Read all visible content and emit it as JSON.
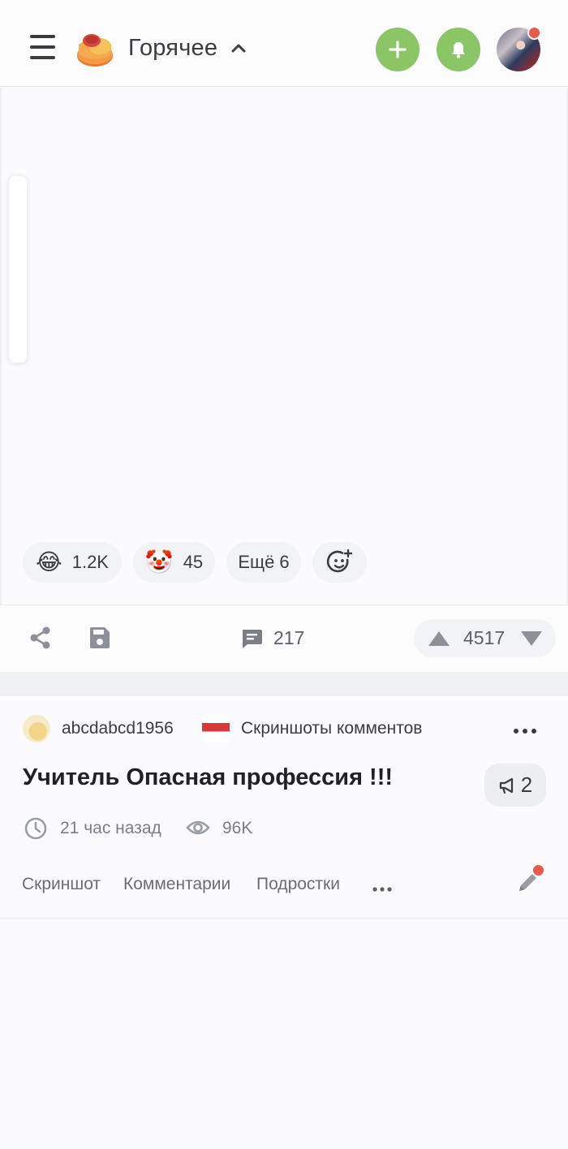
{
  "header": {
    "feed_title": "Горячее",
    "icons": [
      "menu-icon",
      "logo-icon",
      "chevron-up-icon",
      "plus-icon",
      "bell-icon",
      "avatar"
    ],
    "accent_color": "#8bc566",
    "notification_color": "#e85a4a"
  },
  "post1": {
    "reactions": [
      {
        "emoji": "😂",
        "count": "1.2K"
      },
      {
        "emoji": "🤡",
        "count": "45"
      }
    ],
    "more_reactions_label": "Ещё 6",
    "comments_count": "217",
    "rating": "4517"
  },
  "post2": {
    "author": "abcdabcd1956",
    "community": "Скриншоты комментов",
    "title": "Учитель Опасная профессия !!!",
    "mod_count": "2",
    "time_ago": "21 час назад",
    "views": "96K",
    "tags": [
      "Скриншот",
      "Комментарии",
      "Подростки"
    ]
  }
}
